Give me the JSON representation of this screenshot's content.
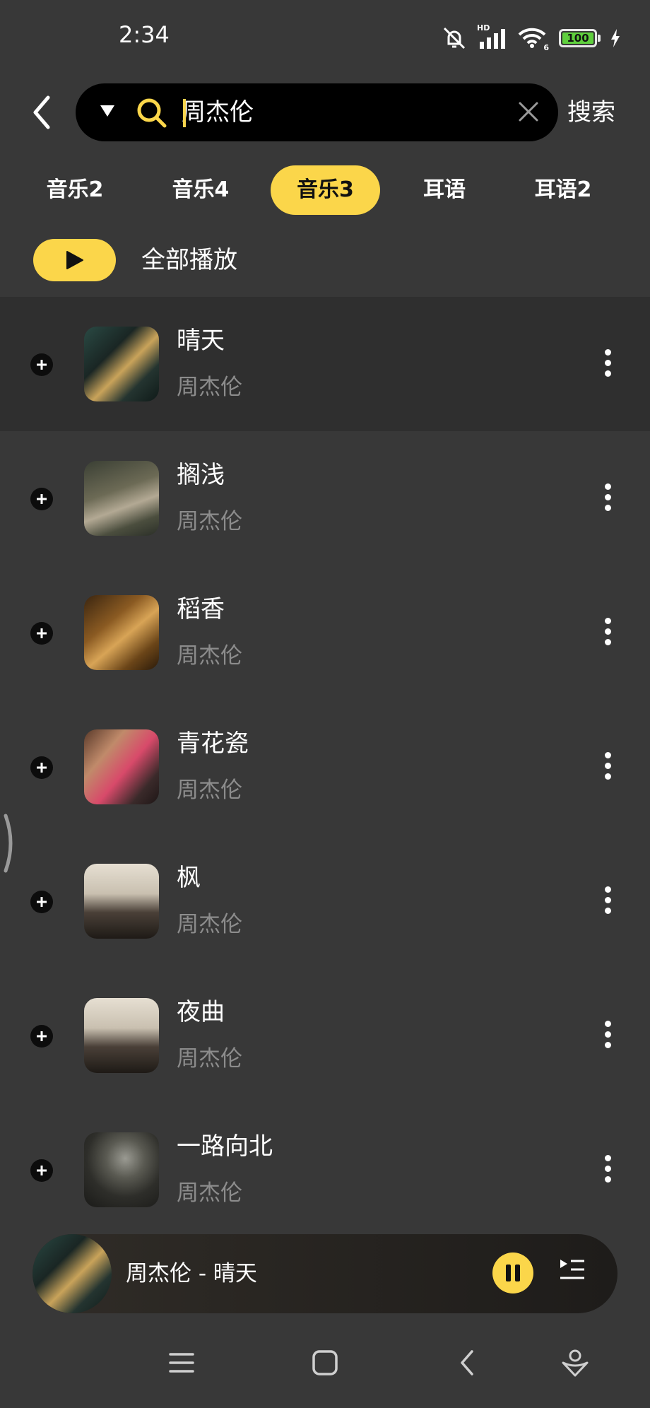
{
  "status": {
    "time": "2:34",
    "battery": "100",
    "network_badge": "HD",
    "wifi_badge": "6"
  },
  "search": {
    "query": "周杰伦",
    "submit_label": "搜索"
  },
  "tabs": [
    {
      "label": "音乐2",
      "active": false
    },
    {
      "label": "音乐4",
      "active": false
    },
    {
      "label": "音乐3",
      "active": true
    },
    {
      "label": "耳语",
      "active": false
    },
    {
      "label": "耳语2",
      "active": false
    }
  ],
  "play_all": {
    "label": "全部播放"
  },
  "songs": [
    {
      "title": "晴天",
      "artist": "周杰伦"
    },
    {
      "title": "搁浅",
      "artist": "周杰伦"
    },
    {
      "title": "稻香",
      "artist": "周杰伦"
    },
    {
      "title": "青花瓷",
      "artist": "周杰伦"
    },
    {
      "title": "枫",
      "artist": "周杰伦"
    },
    {
      "title": "夜曲",
      "artist": "周杰伦"
    },
    {
      "title": "一路向北",
      "artist": "周杰伦"
    }
  ],
  "now_playing": {
    "text": "周杰伦 - 晴天"
  },
  "colors": {
    "accent": "#fbd64a",
    "background": "#383838",
    "secondary_text": "#8c8c8c"
  }
}
